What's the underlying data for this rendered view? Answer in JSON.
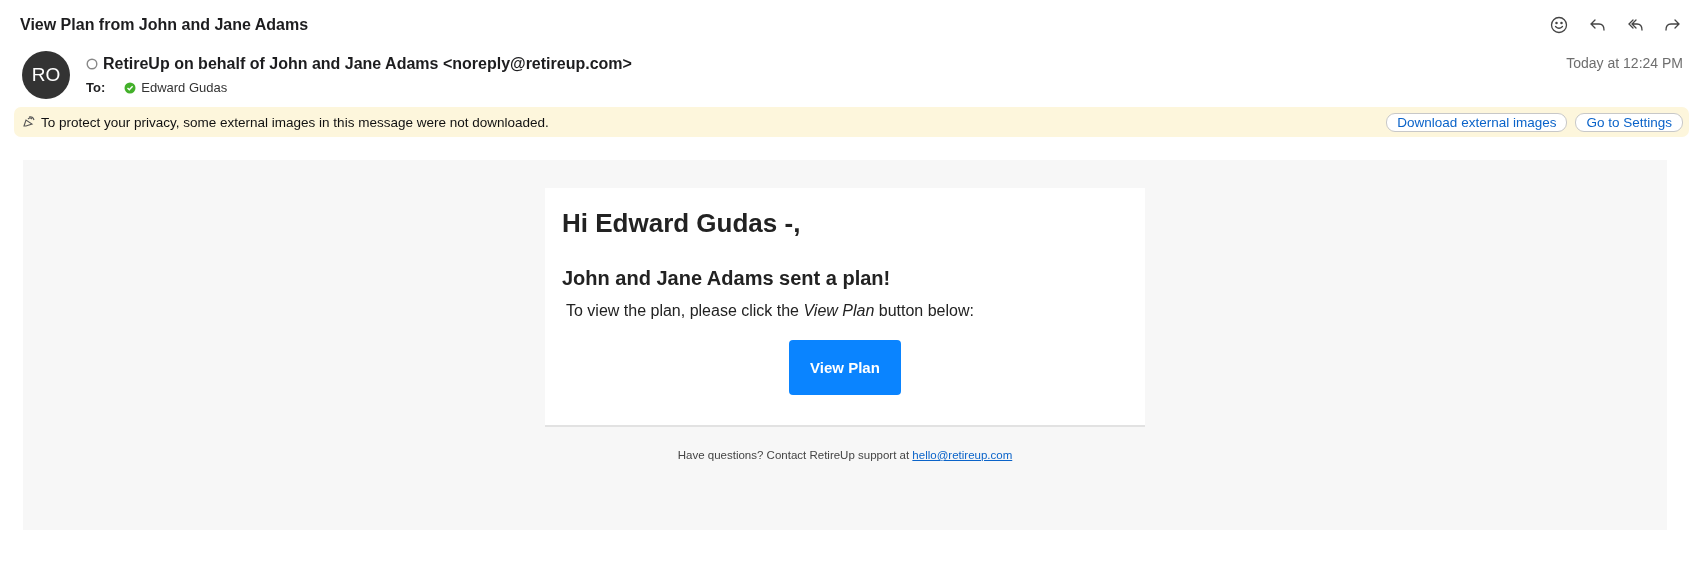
{
  "subject": "View Plan from John and Jane Adams",
  "toolbar": [
    {
      "kind": "emoji"
    },
    {
      "kind": "reply"
    },
    {
      "kind": "reply_all"
    },
    {
      "kind": "forward"
    }
  ],
  "sender": {
    "initials": "RO",
    "name": "RetireUp on behalf of John and Jane Adams <noreply@retireup.com>",
    "verified": false
  },
  "to_label": "To:",
  "recipient": {
    "name": "Edward Gudas",
    "verified": true
  },
  "date": "Today at 12:24 PM",
  "privacy_banner": {
    "text": "To protect your privacy, some external images in this message were not downloaded.",
    "buttons": [
      "Download external images",
      "Go to Settings"
    ]
  },
  "email": {
    "greeting": "Hi Edward Gudas -,",
    "heading": "John and Jane Adams sent a plan!",
    "body": "To view the plan, please click the *View Plan* button below:",
    "button": "View Plan",
    "footer_text": "Have questions? Contact RetireUp support at",
    "footer_link": "hello@retireup.com"
  }
}
